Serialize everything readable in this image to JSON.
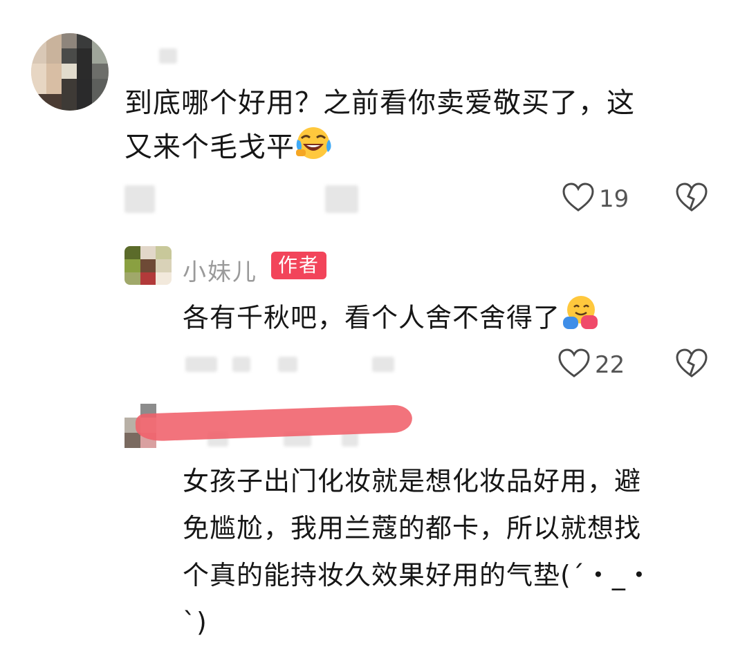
{
  "comments": [
    {
      "text_line1": "到底哪个好用？之前看你卖爱敬买了，这",
      "text_line2": "又来个毛戈平",
      "emoji": "grinning-squinting-tears-emoji",
      "likes": "19"
    }
  ],
  "reply": {
    "username": "小妹儿",
    "badge": "作者",
    "text": "各有千秋吧，看个人舍不舍得了",
    "emoji": "hugging-face-emoji",
    "likes": "22"
  },
  "comment2": {
    "line1": "女孩子出门化妆就是想化妆品好用，避",
    "line2": "免尴尬，我用兰蔻的都卡，所以就想找",
    "line3": "个真的能持妆久效果好用的气垫(ˊ・_・",
    "line4": "ˋ)"
  },
  "colors": {
    "badge": "#f2445a",
    "redaction": "#f0606a"
  }
}
